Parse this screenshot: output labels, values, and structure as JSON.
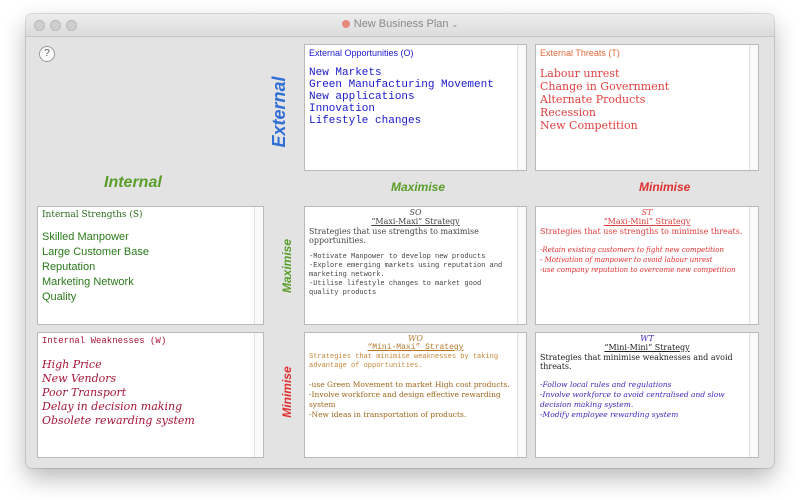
{
  "window": {
    "title": "New Business Plan"
  },
  "labels": {
    "external": "External",
    "internal": "Internal",
    "col_maximise": "Maximise",
    "col_minimise": "Minimise",
    "row_maximise": "Maximise",
    "row_minimise": "Minimise",
    "help": "?"
  },
  "colors": {
    "external": "#2f6fd6",
    "internal": "#5a9e2a",
    "maximise": "#5a9e2a",
    "minimise": "#e03030",
    "opportunities": "#1a1acc",
    "threats": "#e04040",
    "strengths": "#2a7a1a",
    "weaknesses": "#a8163a",
    "so": "#444444",
    "st": "#e04040",
    "wo": "#b8782a",
    "wt": "#3a2ab8"
  },
  "opportunities": {
    "header": "External Opportunities (O)",
    "items": [
      "New Markets",
      "Green Manufacturing Movement",
      "New applications",
      "Innovation",
      "Lifestyle changes"
    ]
  },
  "threats": {
    "header": "External Threats (T)",
    "items": [
      "Labour unrest",
      "Change in Government",
      "Alternate Products",
      "Recession",
      "New Competition"
    ]
  },
  "strengths": {
    "header": "Internal Strengths (S)",
    "items": [
      "Skilled Manpower",
      "Large Customer Base",
      "Reputation",
      "Marketing Network",
      "Quality"
    ]
  },
  "weaknesses": {
    "header": "Internal Weaknesses (W)",
    "items": [
      "High Price",
      "New Vendors",
      "Poor Transport",
      "Delay in decision making",
      "Obsolete rewarding system"
    ]
  },
  "so": {
    "code": "SO",
    "title": "“Maxi-Maxi” Strategy",
    "desc": "Strategies that use strengths to maximise opportunities.",
    "items": [
      "-Motivate Manpower to develop new products",
      "-Explore emerging markets using reputation and marketing network.",
      "-Utilise lifestyle changes to market good quality products"
    ]
  },
  "st": {
    "code": "ST",
    "title": "“Maxi-Mini” Strategy",
    "desc": "Strategies that use strengths to minimise threats.",
    "items": [
      "-Retain existing customers to fight new competition",
      "- Motivation of manpower to avoid labour unrest",
      " -use company reputation to overcome new competition"
    ]
  },
  "wo": {
    "code": "WO",
    "title": "“Mini-Maxi” Strategy",
    "desc": "Strategies that minimise weaknesses by taking advantage of opportunities.",
    "items": [
      "-use Green Movement to market High cost products.",
      "-Involve workforce and design effective rewarding system",
      "-New ideas in transportation of products."
    ]
  },
  "wt": {
    "code": "WT",
    "title": "“Mini-Mini” Strategy",
    "desc": "Strategies that minimise weaknesses and avoid threats.",
    "items": [
      "-Follow local rules and regulations",
      " -Involve workforce to avoid centralised and slow decision making system.",
      " -Modify employee rewarding system"
    ]
  }
}
